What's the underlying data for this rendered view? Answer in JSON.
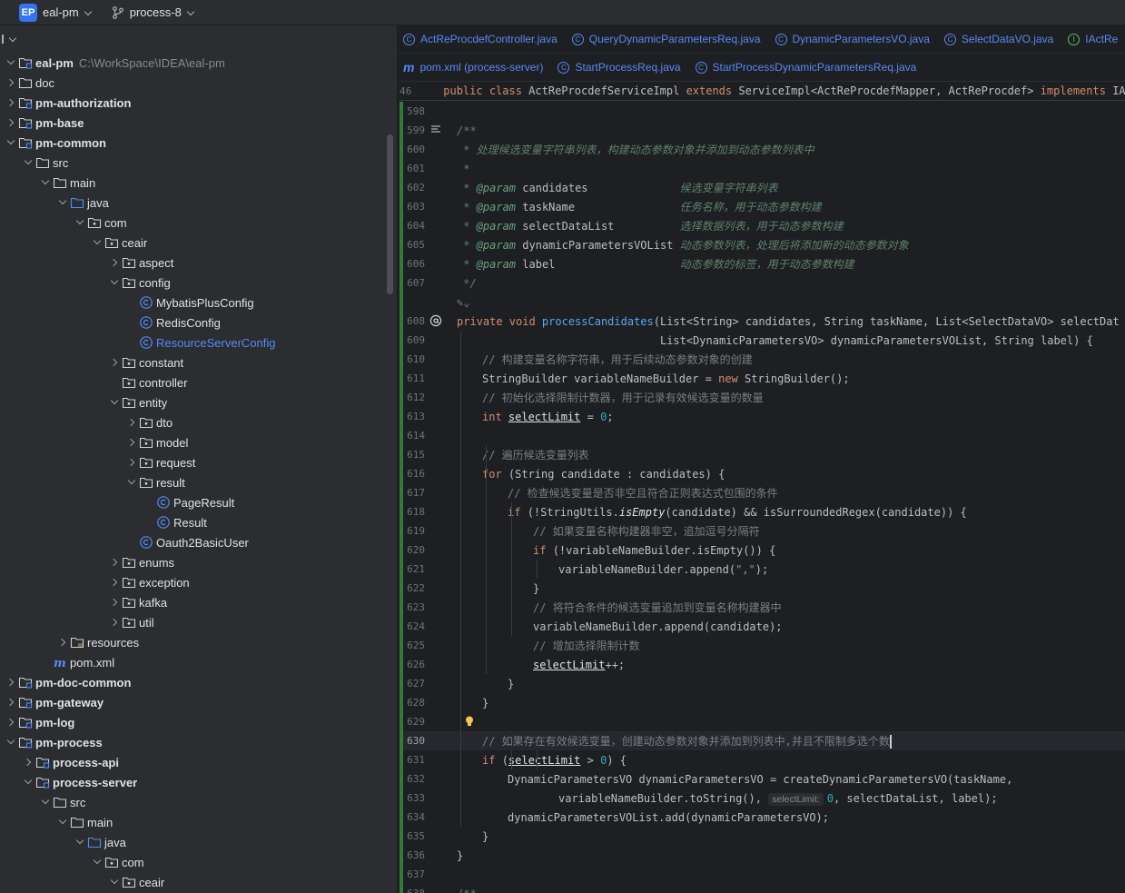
{
  "titlebar": {
    "project_badge": "EP",
    "project_name": "eal-pm",
    "branch": "process-8"
  },
  "tree": [
    {
      "label": "eal-pm",
      "path": "C:\\WorkSpace\\IDEA\\eal-pm",
      "depth": 0,
      "arrow": "expanded",
      "icon": "module-folder",
      "style": "bold"
    },
    {
      "label": "doc",
      "depth": 0,
      "arrow": "collapsed",
      "icon": "folder",
      "style": "normal"
    },
    {
      "label": "pm-authorization",
      "depth": 0,
      "arrow": "collapsed",
      "icon": "module-folder",
      "style": "bold"
    },
    {
      "label": "pm-base",
      "depth": 0,
      "arrow": "collapsed",
      "icon": "module-folder",
      "style": "bold"
    },
    {
      "label": "pm-common",
      "depth": 0,
      "arrow": "expanded",
      "icon": "module-folder",
      "style": "bold"
    },
    {
      "label": "src",
      "depth": 1,
      "arrow": "expanded",
      "icon": "folder",
      "style": "normal"
    },
    {
      "label": "main",
      "depth": 2,
      "arrow": "expanded",
      "icon": "folder",
      "style": "normal"
    },
    {
      "label": "java",
      "depth": 3,
      "arrow": "expanded",
      "icon": "source-folder",
      "style": "normal"
    },
    {
      "label": "com",
      "depth": 4,
      "arrow": "expanded",
      "icon": "package",
      "style": "normal"
    },
    {
      "label": "ceair",
      "depth": 5,
      "arrow": "expanded",
      "icon": "package",
      "style": "normal"
    },
    {
      "label": "aspect",
      "depth": 6,
      "arrow": "collapsed",
      "icon": "package",
      "style": "normal"
    },
    {
      "label": "config",
      "depth": 6,
      "arrow": "expanded",
      "icon": "package",
      "style": "normal"
    },
    {
      "label": "MybatisPlusConfig",
      "depth": 7,
      "arrow": "none",
      "icon": "class",
      "style": "normal"
    },
    {
      "label": "RedisConfig",
      "depth": 7,
      "arrow": "none",
      "icon": "class",
      "style": "normal"
    },
    {
      "label": "ResourceServerConfig",
      "depth": 7,
      "arrow": "none",
      "icon": "class",
      "style": "blue"
    },
    {
      "label": "constant",
      "depth": 6,
      "arrow": "collapsed",
      "icon": "package",
      "style": "normal"
    },
    {
      "label": "controller",
      "depth": 6,
      "arrow": "none",
      "icon": "package",
      "style": "normal"
    },
    {
      "label": "entity",
      "depth": 6,
      "arrow": "expanded",
      "icon": "package",
      "style": "normal"
    },
    {
      "label": "dto",
      "depth": 7,
      "arrow": "collapsed",
      "icon": "package",
      "style": "normal"
    },
    {
      "label": "model",
      "depth": 7,
      "arrow": "collapsed",
      "icon": "package",
      "style": "normal"
    },
    {
      "label": "request",
      "depth": 7,
      "arrow": "collapsed",
      "icon": "package",
      "style": "normal"
    },
    {
      "label": "result",
      "depth": 7,
      "arrow": "expanded",
      "icon": "package",
      "style": "normal"
    },
    {
      "label": "PageResult",
      "depth": 8,
      "arrow": "none",
      "icon": "class",
      "style": "normal"
    },
    {
      "label": "Result",
      "depth": 8,
      "arrow": "none",
      "icon": "class",
      "style": "normal"
    },
    {
      "label": "Oauth2BasicUser",
      "depth": 7,
      "arrow": "none",
      "icon": "class",
      "style": "normal"
    },
    {
      "label": "enums",
      "depth": 6,
      "arrow": "collapsed",
      "icon": "package",
      "style": "normal"
    },
    {
      "label": "exception",
      "depth": 6,
      "arrow": "collapsed",
      "icon": "package",
      "style": "normal"
    },
    {
      "label": "kafka",
      "depth": 6,
      "arrow": "collapsed",
      "icon": "package",
      "style": "normal"
    },
    {
      "label": "util",
      "depth": 6,
      "arrow": "collapsed",
      "icon": "package",
      "style": "normal"
    },
    {
      "label": "resources",
      "depth": 3,
      "arrow": "collapsed",
      "icon": "resources-folder",
      "style": "normal"
    },
    {
      "label": "pom.xml",
      "depth": 2,
      "arrow": "none",
      "icon": "maven",
      "style": "normal"
    },
    {
      "label": "pm-doc-common",
      "depth": 0,
      "arrow": "collapsed",
      "icon": "module-folder",
      "style": "bold"
    },
    {
      "label": "pm-gateway",
      "depth": 0,
      "arrow": "collapsed",
      "icon": "module-folder",
      "style": "bold"
    },
    {
      "label": "pm-log",
      "depth": 0,
      "arrow": "collapsed",
      "icon": "module-folder",
      "style": "bold"
    },
    {
      "label": "pm-process",
      "depth": 0,
      "arrow": "expanded",
      "icon": "module-folder",
      "style": "bold"
    },
    {
      "label": "process-api",
      "depth": 1,
      "arrow": "collapsed",
      "icon": "module-folder",
      "style": "bold"
    },
    {
      "label": "process-server",
      "depth": 1,
      "arrow": "expanded",
      "icon": "module-folder",
      "style": "bold"
    },
    {
      "label": "src",
      "depth": 2,
      "arrow": "expanded",
      "icon": "folder",
      "style": "normal"
    },
    {
      "label": "main",
      "depth": 3,
      "arrow": "expanded",
      "icon": "folder",
      "style": "normal"
    },
    {
      "label": "java",
      "depth": 4,
      "arrow": "expanded",
      "icon": "source-folder",
      "style": "normal"
    },
    {
      "label": "com",
      "depth": 5,
      "arrow": "expanded",
      "icon": "package",
      "style": "normal"
    },
    {
      "label": "ceair",
      "depth": 6,
      "arrow": "expanded",
      "icon": "package",
      "style": "normal"
    }
  ],
  "tabs_row1": [
    {
      "label": "ActReProcdefController.java",
      "icon": "class-icon"
    },
    {
      "label": "QueryDynamicParametersReq.java",
      "icon": "class-icon"
    },
    {
      "label": "DynamicParametersVO.java",
      "icon": "class-icon"
    },
    {
      "label": "SelectDataVO.java",
      "icon": "class-icon"
    },
    {
      "label": "IActRe",
      "icon": "interface-icon"
    }
  ],
  "tabs_row2": [
    {
      "label": "pom.xml (process-server)",
      "icon": "maven-icon"
    },
    {
      "label": "StartProcessReq.java",
      "icon": "class-icon"
    },
    {
      "label": "StartProcessDynamicParametersReq.java",
      "icon": "class-icon"
    }
  ],
  "sticky_header": {
    "line": "46",
    "code": [
      [
        "k",
        "public class "
      ],
      [
        "t",
        "ActReProcdefServiceImpl "
      ],
      [
        "k",
        "extends "
      ],
      [
        "t",
        "ServiceImpl<ActReProcdefMapper, ActReProcdef> "
      ],
      [
        "k",
        "implements "
      ],
      [
        "t",
        "IAc"
      ]
    ]
  },
  "code_lines": [
    {
      "ln": "598",
      "indent": 0,
      "tokens": []
    },
    {
      "ln": "599",
      "indent": 1,
      "gicon": "doc-render-icon",
      "tokens": [
        [
          "dc",
          "/**"
        ]
      ]
    },
    {
      "ln": "600",
      "indent": 1,
      "tokens": [
        [
          "dc",
          " * 处理候选变量字符串列表，构建动态参数对象并添加到动态参数列表中"
        ]
      ]
    },
    {
      "ln": "601",
      "indent": 1,
      "tokens": [
        [
          "dc",
          " *"
        ]
      ]
    },
    {
      "ln": "602",
      "indent": 1,
      "tokens": [
        [
          "dc",
          " * "
        ],
        [
          "dt",
          "@param "
        ],
        [
          "t",
          "candidates              "
        ],
        [
          "dc",
          "候选变量字符串列表"
        ]
      ]
    },
    {
      "ln": "603",
      "indent": 1,
      "tokens": [
        [
          "dc",
          " * "
        ],
        [
          "dt",
          "@param "
        ],
        [
          "t",
          "taskName                "
        ],
        [
          "dc",
          "任务名称，用于动态参数构建"
        ]
      ]
    },
    {
      "ln": "604",
      "indent": 1,
      "tokens": [
        [
          "dc",
          " * "
        ],
        [
          "dt",
          "@param "
        ],
        [
          "t",
          "selectDataList          "
        ],
        [
          "dc",
          "选择数据列表，用于动态参数构建"
        ]
      ]
    },
    {
      "ln": "605",
      "indent": 1,
      "tokens": [
        [
          "dc",
          " * "
        ],
        [
          "dt",
          "@param "
        ],
        [
          "t",
          "dynamicParametersVOList "
        ],
        [
          "dc",
          "动态参数列表，处理后将添加新的动态参数对象"
        ]
      ]
    },
    {
      "ln": "606",
      "indent": 1,
      "tokens": [
        [
          "dc",
          " * "
        ],
        [
          "dt",
          "@param "
        ],
        [
          "t",
          "label                   "
        ],
        [
          "dc",
          "动态参数的标签，用于动态参数构建"
        ]
      ]
    },
    {
      "ln": "607",
      "indent": 1,
      "tokens": [
        [
          "dc",
          " */"
        ]
      ]
    },
    {
      "ln": "",
      "indent": 1,
      "tokens": [
        [
          "c",
          "✎⌄"
        ]
      ]
    },
    {
      "ln": "608",
      "indent": 1,
      "gicon": "at-icon",
      "tokens": [
        [
          "k",
          "private void "
        ],
        [
          "fn",
          "processCandidates"
        ],
        [
          "t",
          "(List<String> candidates, String taskName, List<SelectDataVO> selectDat"
        ]
      ]
    },
    {
      "ln": "609",
      "indent": 1,
      "tokens": [
        [
          "t",
          "                               List<DynamicParametersVO> dynamicParametersVOList, String label) {"
        ]
      ]
    },
    {
      "ln": "610",
      "indent": 2,
      "tokens": [
        [
          "c",
          "// 构建变量名称字符串，用于后续动态参数对象的创建"
        ]
      ]
    },
    {
      "ln": "611",
      "indent": 2,
      "tokens": [
        [
          "t",
          "StringBuilder variableNameBuilder = "
        ],
        [
          "k",
          "new "
        ],
        [
          "t",
          "StringBuilder();"
        ]
      ]
    },
    {
      "ln": "612",
      "indent": 2,
      "tokens": [
        [
          "c",
          "// 初始化选择限制计数器，用于记录有效候选变量的数量"
        ]
      ]
    },
    {
      "ln": "613",
      "indent": 2,
      "tokens": [
        [
          "k",
          "int "
        ],
        [
          "ul",
          "selectLimit"
        ],
        [
          "t",
          " = "
        ],
        [
          "n",
          "0"
        ],
        [
          "t",
          ";"
        ]
      ]
    },
    {
      "ln": "614",
      "indent": 0,
      "tokens": []
    },
    {
      "ln": "615",
      "indent": 2,
      "tokens": [
        [
          "c",
          "// 遍历候选变量列表"
        ]
      ]
    },
    {
      "ln": "616",
      "indent": 2,
      "tokens": [
        [
          "k",
          "for "
        ],
        [
          "t",
          "(String candidate : candidates) {"
        ]
      ]
    },
    {
      "ln": "617",
      "indent": 3,
      "tokens": [
        [
          "c",
          "// 检查候选变量是否非空且符合正则表达式包围的条件"
        ]
      ]
    },
    {
      "ln": "618",
      "indent": 3,
      "tokens": [
        [
          "k",
          "if "
        ],
        [
          "t",
          "(!StringUtils."
        ],
        [
          "it",
          "isEmpty"
        ],
        [
          "t",
          "(candidate) && isSurroundedRegex(candidate)) {"
        ]
      ]
    },
    {
      "ln": "619",
      "indent": 4,
      "tokens": [
        [
          "c",
          "// 如果变量名称构建器非空，追加逗号分隔符"
        ]
      ]
    },
    {
      "ln": "620",
      "indent": 4,
      "tokens": [
        [
          "k",
          "if "
        ],
        [
          "t",
          "(!variableNameBuilder.isEmpty()) {"
        ]
      ]
    },
    {
      "ln": "621",
      "indent": 5,
      "tokens": [
        [
          "t",
          "variableNameBuilder.append("
        ],
        [
          "s",
          "\",\""
        ],
        [
          "t",
          ");"
        ]
      ]
    },
    {
      "ln": "622",
      "indent": 4,
      "tokens": [
        [
          "t",
          "}"
        ]
      ]
    },
    {
      "ln": "623",
      "indent": 4,
      "tokens": [
        [
          "c",
          "// 将符合条件的候选变量追加到变量名称构建器中"
        ]
      ]
    },
    {
      "ln": "624",
      "indent": 4,
      "tokens": [
        [
          "t",
          "variableNameBuilder.append(candidate);"
        ]
      ]
    },
    {
      "ln": "625",
      "indent": 4,
      "tokens": [
        [
          "c",
          "// 增加选择限制计数"
        ]
      ]
    },
    {
      "ln": "626",
      "indent": 4,
      "tokens": [
        [
          "ul",
          "selectLimit"
        ],
        [
          "t",
          "++;"
        ]
      ]
    },
    {
      "ln": "627",
      "indent": 3,
      "tokens": [
        [
          "t",
          "}"
        ]
      ]
    },
    {
      "ln": "628",
      "indent": 2,
      "tokens": [
        [
          "t",
          "}"
        ]
      ]
    },
    {
      "ln": "629",
      "indent": 0,
      "gicon": "bulb-icon",
      "tokens": []
    },
    {
      "ln": "630",
      "indent": 2,
      "current": true,
      "tokens": [
        [
          "c",
          "// 如果存在有效候选变量，创建动态参数对象并添加到列表中,并且不限制多选个数"
        ],
        [
          "caret",
          ""
        ]
      ]
    },
    {
      "ln": "631",
      "indent": 2,
      "tokens": [
        [
          "k",
          "if "
        ],
        [
          "t",
          "("
        ],
        [
          "ul",
          "selectLimit"
        ],
        [
          "t",
          " > "
        ],
        [
          "n",
          "0"
        ],
        [
          "t",
          ") {"
        ]
      ]
    },
    {
      "ln": "632",
      "indent": 3,
      "tokens": [
        [
          "t",
          "DynamicParametersVO dynamicParametersVO = createDynamicParametersVO(taskName,"
        ]
      ]
    },
    {
      "ln": "633",
      "indent": 5,
      "tokens": [
        [
          "t",
          "variableNameBuilder.toString(), "
        ],
        [
          "hint",
          "selectLimit:"
        ],
        [
          "n",
          "0"
        ],
        [
          "t",
          ", selectDataList, label);"
        ]
      ]
    },
    {
      "ln": "634",
      "indent": 3,
      "tokens": [
        [
          "t",
          "dynamicParametersVOList.add(dynamicParametersVO);"
        ]
      ]
    },
    {
      "ln": "635",
      "indent": 2,
      "tokens": [
        [
          "t",
          "}"
        ]
      ]
    },
    {
      "ln": "636",
      "indent": 1,
      "tokens": [
        [
          "t",
          "}"
        ]
      ]
    },
    {
      "ln": "637",
      "indent": 0,
      "tokens": []
    },
    {
      "ln": "638",
      "indent": 1,
      "tokens": [
        [
          "dc",
          "/**"
        ]
      ]
    }
  ],
  "colors": {
    "accent": "#3574f0",
    "keyword": "#cf8e6d",
    "comment": "#7a7e85",
    "doc_comment": "#5f826b",
    "function": "#56a8f5",
    "number": "#2aacb8",
    "string": "#6aab73",
    "vcs_added": "#2e7d32"
  }
}
